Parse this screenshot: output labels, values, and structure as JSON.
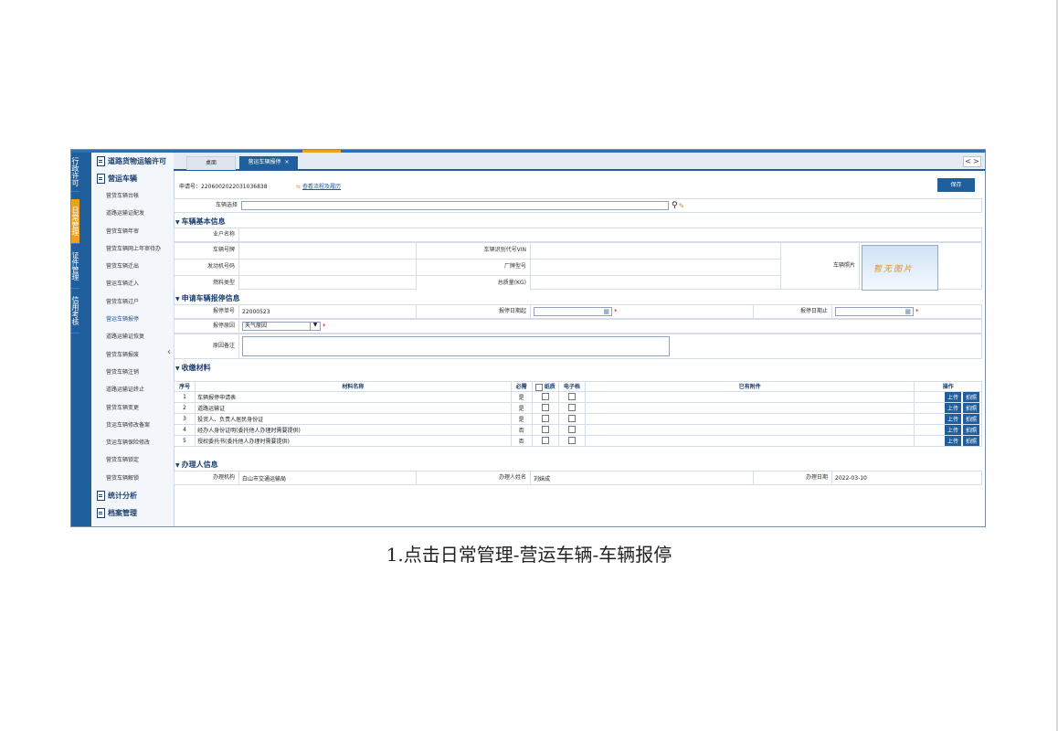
{
  "sidebar_tabs": [
    {
      "label": "行政许可"
    },
    {
      "label": "日常管理"
    },
    {
      "label": "证件管理"
    },
    {
      "label": "信用考核"
    }
  ],
  "menu": {
    "group1": "道路货物运输许可",
    "group2": "营运车辆",
    "items": [
      "营货车辆台帐",
      "道路运输证配发",
      "营货车辆年审",
      "营货车辆网上年审待办",
      "营货车辆迁出",
      "营运车辆迁入",
      "营货车辆过户",
      "营运车辆报停",
      "道路运输证恢复",
      "营货车辆报废",
      "营货车辆注销",
      "道路运输证终止",
      "营货车辆变更",
      "货运车辆修改备案",
      "货运车辆保险修改",
      "营货车辆锁定",
      "营货车辆解锁"
    ],
    "group3": "统计分析",
    "group4": "档案管理"
  },
  "tabs": {
    "home": "桌面",
    "current": "营运车辆报停",
    "close": "×",
    "prev": "<",
    "next": ">"
  },
  "apply_no": "申请号：22060020220310368​38",
  "flow_link": "查看流程及履历",
  "save": "保存",
  "vehicle_select_label": "车辆选择",
  "basic": {
    "title": "车辆基本信息",
    "owner": "业户名称",
    "plate": "车辆号牌",
    "vin": "车辆识别代号VIN",
    "engine": "发动机号码",
    "model": "厂牌型号",
    "fuel": "燃料类型",
    "mass": "总质量(KG)",
    "photo_label": "车辆照片",
    "photo_text": "暂无图片"
  },
  "apply": {
    "title": "申请车辆报停信息",
    "no_label": "报停单号",
    "no_value": "22000523",
    "start_label": "报停日期起",
    "end_label": "报停日期止",
    "reason_label": "报停原因",
    "reason_value": "天气原因",
    "remark_label": "原因备注",
    "req": "*"
  },
  "materials": {
    "title": "收缴材料",
    "headers": [
      "序号",
      "材料名称",
      "必需",
      "纸质",
      "电子档",
      "已有附件",
      "操作"
    ],
    "rows": [
      {
        "no": "1",
        "name": "车辆报停申请表",
        "req": "是"
      },
      {
        "no": "2",
        "name": "道路运输证",
        "req": "是"
      },
      {
        "no": "3",
        "name": "投资人、负责人居民身份证",
        "req": "是"
      },
      {
        "no": "4",
        "name": "经办人身份证明(委托他人办理时需要提供)",
        "req": "否"
      },
      {
        "no": "5",
        "name": "授权委托书(委托他人办理时需要提供)",
        "req": "否"
      }
    ],
    "upload": "上传",
    "photo": "拍照"
  },
  "handler": {
    "title": "办理人信息",
    "org_label": "办理机构",
    "org_value": "白山市交通运输局",
    "name_label": "办理人姓名",
    "name_value": "刘妹成",
    "date_label": "办理日期",
    "date_value": "2022-03-10"
  },
  "caption": "1.点击日常管理-营运车辆-车辆报停"
}
